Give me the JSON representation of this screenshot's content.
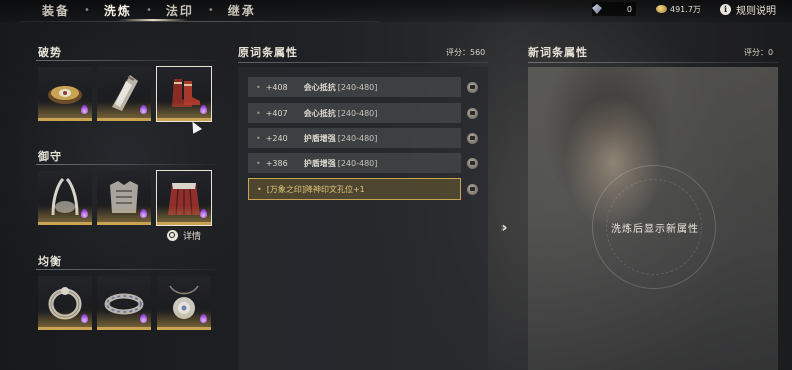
{
  "nav": {
    "tabs": [
      {
        "label": "装备"
      },
      {
        "label": "洗炼"
      },
      {
        "label": "法印"
      },
      {
        "label": "继承"
      }
    ],
    "active_tab": "洗炼"
  },
  "currency": {
    "jade_amount": "0",
    "gold_amount": "491.7万"
  },
  "rules_label": "规则说明",
  "groups": [
    {
      "title": "破势",
      "items": [
        "armor-bracer",
        "gauntlet",
        "boots"
      ]
    },
    {
      "title": "御守",
      "items": [
        "helmet-ornament",
        "chest-armor",
        "waist-skirt"
      ]
    },
    {
      "title": "均衡",
      "items": [
        "ring",
        "bracelet",
        "pendant"
      ]
    }
  ],
  "detail_label": "详情",
  "original": {
    "title": "原词条属性",
    "score": "评分：560",
    "attributes": [
      {
        "value": "+408",
        "name": "会心抵抗",
        "range": "[240-480]"
      },
      {
        "value": "+407",
        "name": "会心抵抗",
        "range": "[240-480]"
      },
      {
        "value": "+240",
        "name": "护盾增强",
        "range": "[240-480]"
      },
      {
        "value": "+386",
        "name": "护盾增强",
        "range": "[240-480]"
      }
    ],
    "special": "[万象之印]降神印文孔位+1"
  },
  "new": {
    "title": "新词条属性",
    "score": "评分：0",
    "hint": "洗炼后显示新属性"
  },
  "colors": {
    "accent_gold": "#c9a453",
    "rarity_purple": "#8d3fd0"
  }
}
